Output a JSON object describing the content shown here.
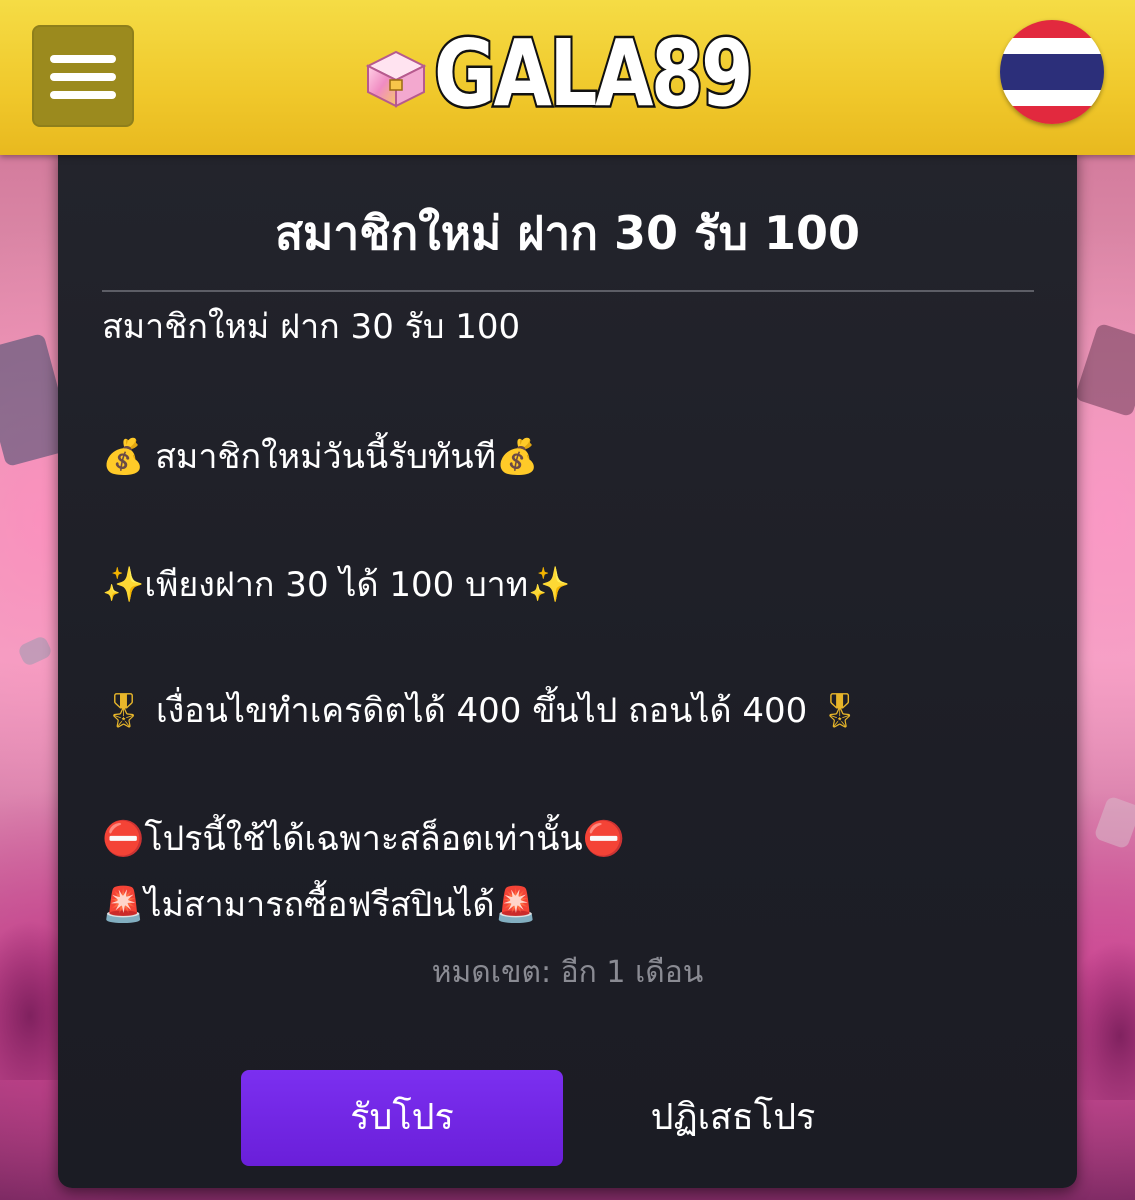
{
  "header": {
    "menu_icon": "hamburger-menu-icon",
    "logo_text": "GALA89",
    "logo_icon": "treasure-chest-icon",
    "language_flag": "thailand-flag-icon"
  },
  "modal": {
    "title": "สมาชิกใหม่ ฝาก 30 รับ 100",
    "lines": [
      {
        "prefix": "",
        "text": "สมาชิกใหม่ ฝาก 30 รับ 100",
        "suffix": ""
      },
      {
        "prefix": "💰",
        "text": " สมาชิกใหม่วันนี้รับทันที",
        "suffix": "💰"
      },
      {
        "prefix": "✨",
        "text": "เพียงฝาก 30 ได้ 100 บาท",
        "suffix": "✨"
      },
      {
        "prefix": "🎖",
        "text": " เงื่อนไขทำเครดิตได้ 400 ขึ้นไป ถอนได้ 400 ",
        "suffix": "🎖"
      },
      {
        "prefix": "⛔",
        "text": "โปรนี้ใช้ได้เฉพาะสล็อตเท่านั้น",
        "suffix": "⛔"
      },
      {
        "prefix": "🚨",
        "text": "ไม่สามารถซื้อฟรีสปินได้",
        "suffix": "🚨"
      }
    ],
    "expiry": "หมดเขต: อีก 1 เดือน",
    "accept_label": "รับโปร",
    "decline_label": "ปฏิเสธโปร"
  },
  "colors": {
    "header_yellow": "#f0c82b",
    "modal_bg": "#1d1e26",
    "accept_purple": "#6a1fd9",
    "expiry_gray": "#8a8b93"
  }
}
